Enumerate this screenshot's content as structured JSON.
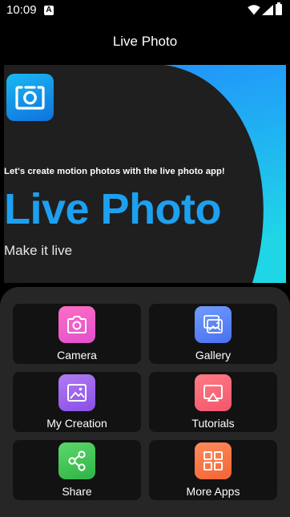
{
  "status_bar": {
    "time": "10:09",
    "notification_badge": "A",
    "icons": [
      "wifi-icon",
      "cellular-signal-icon",
      "battery-icon"
    ]
  },
  "app_bar": {
    "title": "Live Photo"
  },
  "banner": {
    "tagline": "Let's create motion photos with the live photo app!",
    "title": "Live Photo",
    "subtitle": "Make it live",
    "logo_icon": "camera-live-icon",
    "colors": {
      "title": "#1ea0f0",
      "gradient_start": "#2288ff",
      "gradient_end": "#1fd6e6",
      "dark": "#1f1f1f"
    }
  },
  "menu": {
    "items": [
      {
        "label": "Camera",
        "icon": "camera-icon",
        "gradient": [
          "#ff6ec4",
          "#e24fcf"
        ]
      },
      {
        "label": "Gallery",
        "icon": "gallery-icon",
        "gradient": [
          "#6f9dff",
          "#4a6ff0"
        ]
      },
      {
        "label": "My Creation",
        "icon": "image-icon",
        "gradient": [
          "#b07cf4",
          "#8a4ee6"
        ]
      },
      {
        "label": "Tutorials",
        "icon": "cast-icon",
        "gradient": [
          "#ff7b86",
          "#f2566c"
        ]
      },
      {
        "label": "Share",
        "icon": "share-icon",
        "gradient": [
          "#5cd86a",
          "#2fb347"
        ]
      },
      {
        "label": "More Apps",
        "icon": "grid-icon",
        "gradient": [
          "#ff8b5a",
          "#f26535"
        ]
      }
    ]
  }
}
